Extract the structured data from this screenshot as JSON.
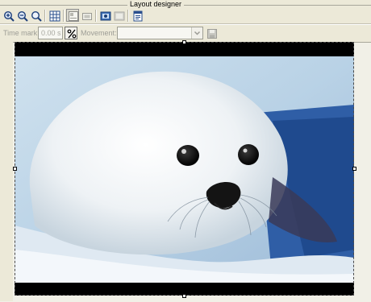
{
  "panel": {
    "title": "Layout designer"
  },
  "toolbar": {
    "zoom_in_icon": "zoom-in-icon",
    "zoom_out_icon": "zoom-out-icon",
    "zoom_fit_icon": "zoom-fit-icon",
    "grid_icon": "grid-icon"
  },
  "timebar": {
    "time_mark_label": "Time mark:",
    "time_mark_value": "0.00 s",
    "movement_label": "Movement:",
    "movement_value": ""
  },
  "colors": {
    "background": "#ece9d8",
    "canvas": "#f1f0e7",
    "stage": "#000000",
    "disabled_text": "#9d9d96"
  }
}
